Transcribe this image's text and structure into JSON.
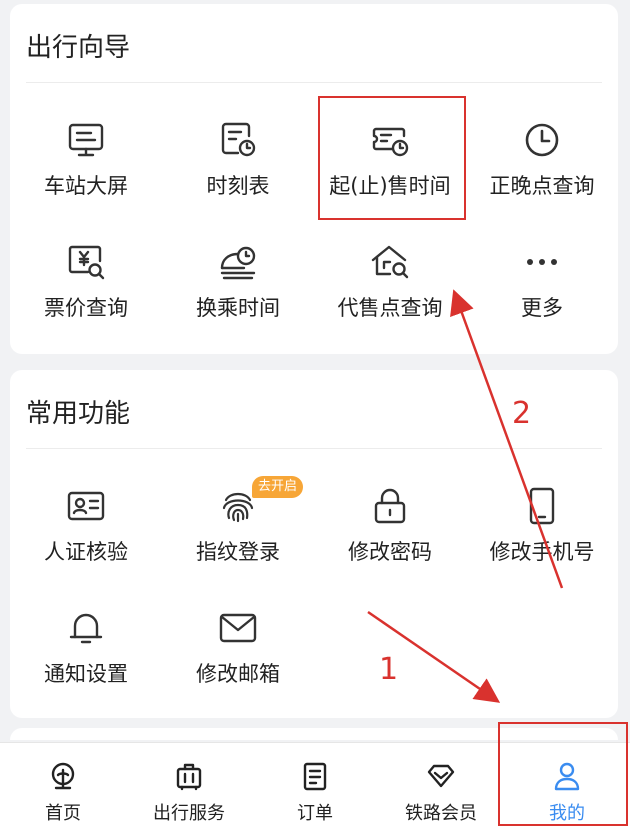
{
  "guide": {
    "title": "出行向导",
    "items": [
      {
        "label": "车站大屏",
        "icon": "monitor-icon"
      },
      {
        "label": "时刻表",
        "icon": "timetable-icon"
      },
      {
        "label": "起(止)售时间",
        "icon": "ticket-clock-icon"
      },
      {
        "label": "正晚点查询",
        "icon": "clock-icon"
      },
      {
        "label": "票价查询",
        "icon": "price-search-icon"
      },
      {
        "label": "换乘时间",
        "icon": "train-clock-icon"
      },
      {
        "label": "代售点查询",
        "icon": "house-search-icon"
      },
      {
        "label": "更多",
        "icon": "more-dots-icon"
      }
    ]
  },
  "common": {
    "title": "常用功能",
    "items": [
      {
        "label": "人证核验",
        "icon": "id-card-icon"
      },
      {
        "label": "指纹登录",
        "icon": "fingerprint-icon",
        "badge": "去开启"
      },
      {
        "label": "修改密码",
        "icon": "lock-icon"
      },
      {
        "label": "修改手机号",
        "icon": "phone-icon"
      },
      {
        "label": "通知设置",
        "icon": "bell-icon"
      },
      {
        "label": "修改邮箱",
        "icon": "mail-icon"
      }
    ]
  },
  "tabbar": {
    "tabs": [
      {
        "label": "首页",
        "icon": "railway-logo-icon",
        "active": false
      },
      {
        "label": "出行服务",
        "icon": "luggage-icon",
        "active": false
      },
      {
        "label": "订单",
        "icon": "order-list-icon",
        "active": false
      },
      {
        "label": "铁路会员",
        "icon": "diamond-icon",
        "active": false
      },
      {
        "label": "我的",
        "icon": "user-icon",
        "active": true
      }
    ]
  },
  "annotations": {
    "step1": "1",
    "step2": "2",
    "color": "#d9322e"
  },
  "colors": {
    "accent": "#3a8cf0",
    "badge": "#f7a637",
    "background": "#f1f2f4"
  }
}
